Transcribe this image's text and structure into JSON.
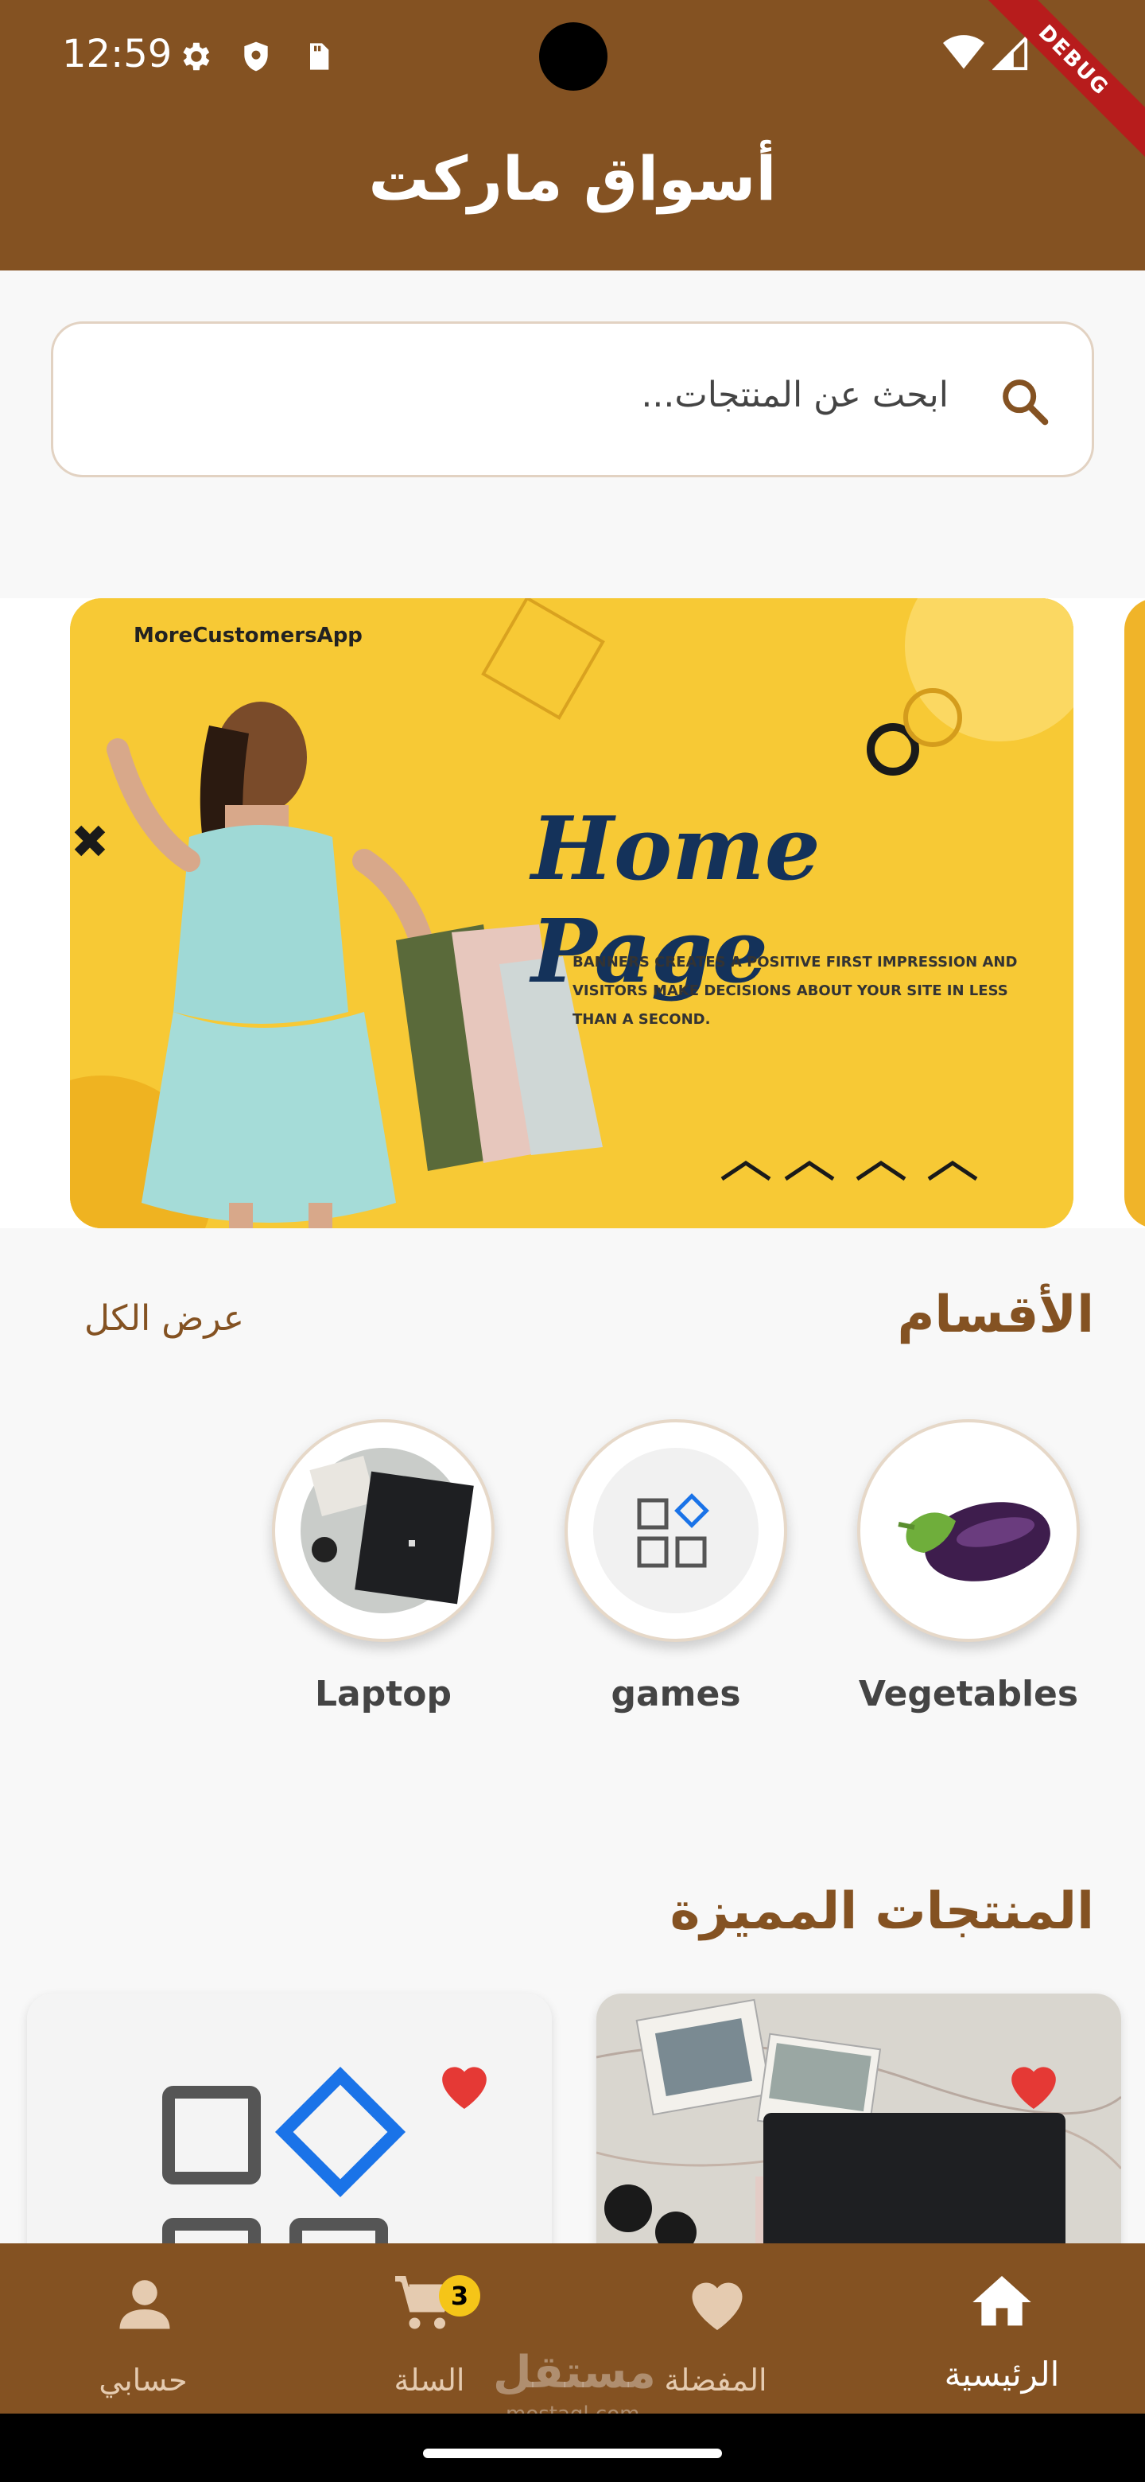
{
  "status_bar": {
    "time": "12:59",
    "debug_label": "DEBUG",
    "icons": [
      "gear-icon",
      "shield-icon",
      "sd-card-icon",
      "wifi-icon",
      "signal-icon"
    ]
  },
  "app_bar": {
    "title": "أسواق ماركت"
  },
  "search": {
    "placeholder": "ابحث عن المنتجات..."
  },
  "banner": {
    "brand": "MoreCustomersApp",
    "headline": "Home Page",
    "subtext": "BANNERS CREATES A POSITIVE FIRST IMPRESSION AND VISITORS MAKE DECISIONS ABOUT YOUR SITE IN LESS THAN A SECOND."
  },
  "categories": {
    "title": "الأقسام",
    "view_all": "عرض الكل",
    "items": [
      {
        "label": "Vegetables",
        "icon": "eggplant-icon"
      },
      {
        "label": "games",
        "icon": "grid-diamond-icon"
      },
      {
        "label": "Laptop",
        "icon": "laptop-image"
      }
    ]
  },
  "featured": {
    "title": "المنتجات المميزة",
    "products": [
      {
        "image": "laptop-on-map-image",
        "favorite": true
      },
      {
        "image": "grid-diamond-icon",
        "favorite": true
      }
    ]
  },
  "bottom_nav": {
    "items": [
      {
        "label": "الرئيسية",
        "icon": "home-icon",
        "active": true
      },
      {
        "label": "المفضلة",
        "icon": "heart-icon",
        "active": false
      },
      {
        "label": "السلة",
        "icon": "cart-icon",
        "active": false,
        "badge": "3"
      },
      {
        "label": "حسابي",
        "icon": "person-icon",
        "active": false
      }
    ]
  },
  "watermark": {
    "text": "مستقل",
    "sub": "mostaql.com"
  },
  "colors": {
    "primary": "#845222",
    "accent_blue": "#1a73e8",
    "heart": "#e53935",
    "badge": "#f5c518"
  }
}
